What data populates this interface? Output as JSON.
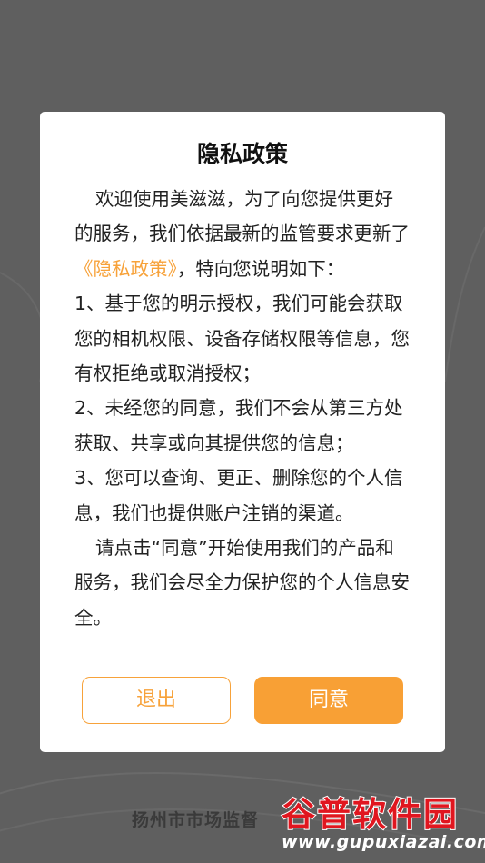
{
  "dialog": {
    "title": "隐私政策",
    "intro_line1": "欢迎使用美滋滋，为了向您提供更好的服务，我们依据最新的监管要求更新了",
    "policy_link": "《隐私政策》",
    "intro_line2": "，特向您说明如下：",
    "item1": "1、基于您的明示授权，我们可能会获取您的相机权限、设备存储权限等信息，您有权拒绝或取消授权；",
    "item2": "2、未经您的同意，我们不会从第三方处获取、共享或向其提供您的信息；",
    "item3": "3、您可以查询、更正、删除您的个人信息，我们也提供账户注销的渠道。",
    "closing": "请点击“同意”开始使用我们的产品和服务，我们会尽全力保护您的个人信息安全。",
    "exit_label": "退出",
    "agree_label": "同意"
  },
  "background": {
    "bottom_text": "扬州市市场监督"
  },
  "watermark": {
    "title": "谷普软件园",
    "url": "www.gupuxiazai.com"
  },
  "colors": {
    "accent": "#f8a035",
    "overlay": "#5f5f5f",
    "watermark_red": "#e0161f"
  }
}
